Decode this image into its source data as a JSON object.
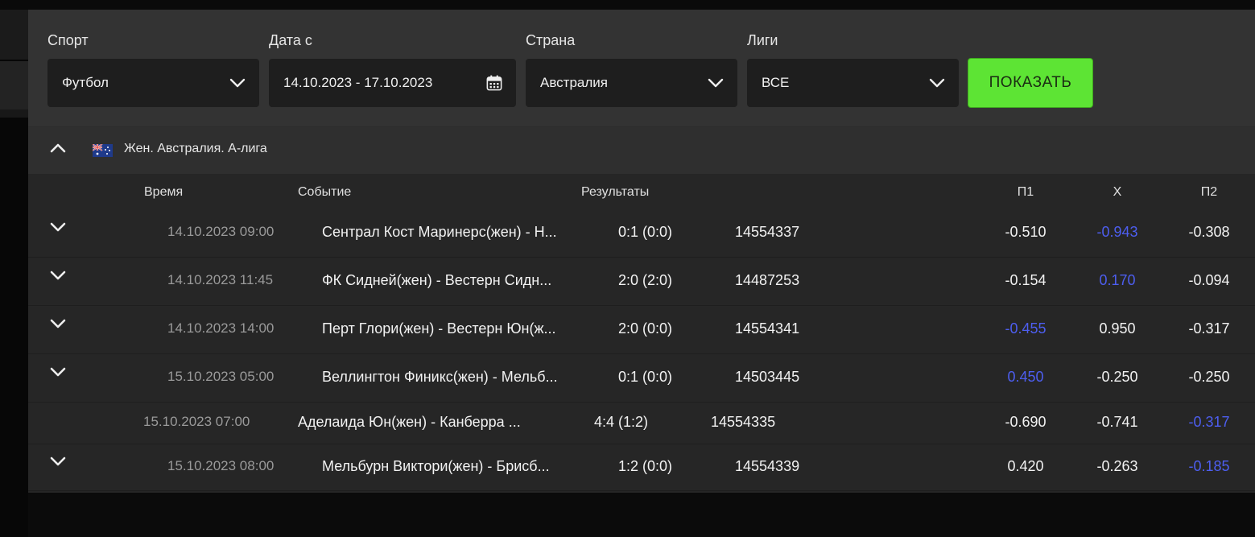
{
  "filters": {
    "sport": {
      "label": "Спорт",
      "value": "Футбол"
    },
    "date": {
      "label": "Дата с",
      "value": "14.10.2023 - 17.10.2023"
    },
    "country": {
      "label": "Страна",
      "value": "Австралия"
    },
    "leagues": {
      "label": "Лиги",
      "value": "ВСЕ"
    },
    "show_button": "ПОКАЗАТЬ"
  },
  "league": {
    "title": "Жен. Австралия. А-лига",
    "flag_icon": "australia-flag-icon"
  },
  "columns": {
    "time": "Время",
    "event": "Событие",
    "results": "Результаты",
    "p1": "П1",
    "x": "X",
    "p2": "П2"
  },
  "rows": [
    {
      "time": "14.10.2023 09:00",
      "event": "Сентрал Кост Маринерс(жен) - Н...",
      "result": "0:1 (0:0)",
      "id": "14554337",
      "p1": "-0.510",
      "x": "-0.943",
      "p2": "-0.308",
      "expandable": true,
      "highlight": "x"
    },
    {
      "time": "14.10.2023 11:45",
      "event": "ФК Сидней(жен) - Вестерн Сидн...",
      "result": "2:0 (2:0)",
      "id": "14487253",
      "p1": "-0.154",
      "x": "0.170",
      "p2": "-0.094",
      "expandable": true,
      "highlight": "x"
    },
    {
      "time": "14.10.2023 14:00",
      "event": "Перт Глори(жен) - Вестерн Юн(ж...",
      "result": "2:0 (0:0)",
      "id": "14554341",
      "p1": "-0.455",
      "x": "0.950",
      "p2": "-0.317",
      "expandable": true,
      "highlight": "p1"
    },
    {
      "time": "15.10.2023 05:00",
      "event": "Веллингтон Финикс(жен) - Мельб...",
      "result": "0:1 (0:0)",
      "id": "14503445",
      "p1": "0.450",
      "x": "-0.250",
      "p2": "-0.250",
      "expandable": true,
      "highlight": "p1"
    },
    {
      "time": "15.10.2023 07:00",
      "event": "Аделаида Юн(жен) - Канберра ...",
      "result": "4:4 (1:2)",
      "id": "14554335",
      "p1": "-0.690",
      "x": "-0.741",
      "p2": "-0.317",
      "expandable": false,
      "highlight": "p2"
    },
    {
      "time": "15.10.2023 08:00",
      "event": "Мельбурн Виктори(жен) - Брисб...",
      "result": "1:2 (0:0)",
      "id": "14554339",
      "p1": "0.420",
      "x": "-0.263",
      "p2": "-0.185",
      "expandable": true,
      "highlight": "p2"
    }
  ],
  "colors": {
    "accent_green": "#5de434",
    "highlight_blue": "#4d5ef0"
  }
}
